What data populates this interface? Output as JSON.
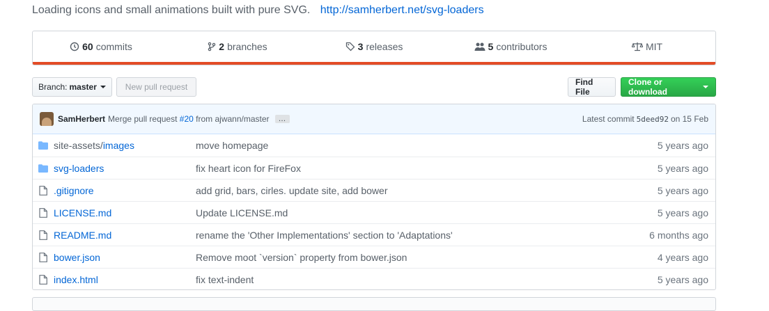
{
  "description": {
    "text": "Loading icons and small animations built with pure SVG.",
    "link": "http://samherbert.net/svg-loaders"
  },
  "summary": {
    "commits_count": "60",
    "commits_label": "commits",
    "branches_count": "2",
    "branches_label": "branches",
    "releases_count": "3",
    "releases_label": "releases",
    "contributors_count": "5",
    "contributors_label": "contributors",
    "license": "MIT",
    "language_color": "#e34c26"
  },
  "toolbar": {
    "branch_label": "Branch:",
    "branch_value": "master",
    "new_pr": "New pull request",
    "find_file": "Find File",
    "clone": "Clone or download"
  },
  "commit": {
    "author": "SamHerbert",
    "message_prefix": "Merge pull request",
    "pr": "#20",
    "message_suffix": "from ajwann/master",
    "ellipsis": "…",
    "latest_label": "Latest commit",
    "sha": "5deed92",
    "date": "on 15 Feb"
  },
  "files": [
    {
      "type": "folder",
      "name_dim": "site-assets/",
      "name": "images",
      "message": "move homepage",
      "age": "5 years ago"
    },
    {
      "type": "folder",
      "name_dim": "",
      "name": "svg-loaders",
      "message": "fix heart icon for FireFox",
      "age": "5 years ago"
    },
    {
      "type": "file",
      "name_dim": "",
      "name": ".gitignore",
      "message": "add grid, bars, cirles. update site, add bower",
      "age": "5 years ago"
    },
    {
      "type": "file",
      "name_dim": "",
      "name": "LICENSE.md",
      "message": "Update LICENSE.md",
      "age": "5 years ago"
    },
    {
      "type": "file",
      "name_dim": "",
      "name": "README.md",
      "message": "rename the 'Other Implementations' section to 'Adaptations'",
      "age": "6 months ago"
    },
    {
      "type": "file",
      "name_dim": "",
      "name": "bower.json",
      "message": "Remove moot `version` property from bower.json",
      "age": "4 years ago"
    },
    {
      "type": "file",
      "name_dim": "",
      "name": "index.html",
      "message": "fix text-indent",
      "age": "5 years ago"
    }
  ]
}
